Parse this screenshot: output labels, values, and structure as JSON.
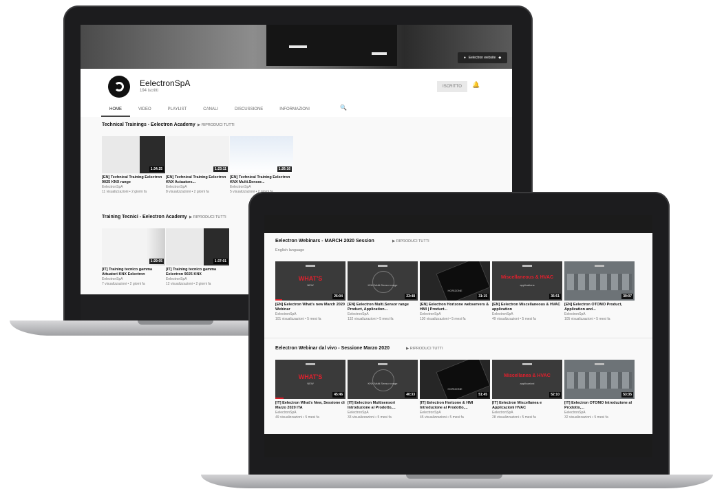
{
  "channel": {
    "banner_link": "Eelectron website",
    "name": "EelectronSpA",
    "subscribers": "194 iscritti",
    "subscribe_label": "ISCRITTO",
    "tabs": [
      "HOME",
      "VIDEO",
      "PLAYLIST",
      "CANALI",
      "DISCUSSIONE",
      "INFORMAZIONI"
    ],
    "sections": [
      {
        "title": "Technical Trainings - Eelectron Academy",
        "play_all": "RIPRODUCI TUTTI",
        "videos": [
          {
            "duration": "1:34:25",
            "title": "[EN] Technical Training Eelectron 9025 KNX range",
            "author": "EelectronSpA",
            "meta": "11 visualizzazioni • 2 giorni fa"
          },
          {
            "duration": "1:23:11",
            "title": "[EN] Technical Training Eelectron KNX Actuators...",
            "author": "EelectronSpA",
            "meta": "8 visualizzazioni • 2 giorni fa"
          },
          {
            "duration": "1:26:16",
            "title": "[EN] Technical Training Eelectron KNX Multi.Sensor...",
            "author": "EelectronSpA",
            "meta": "5 visualizzazioni • 2 giorni fa"
          }
        ]
      },
      {
        "title": "Training Tecnici - Eelectron Academy",
        "play_all": "RIPRODUCI TUTTI",
        "videos": [
          {
            "duration": "1:29:05",
            "title": "[IT] Training tecnico gamma Attuatori KNX Eelectron",
            "author": "EelectronSpA",
            "meta": "7 visualizzazioni • 2 giorni fa"
          },
          {
            "duration": "1:37:01",
            "title": "[IT] Training tecnico gamma Eelectron 9025 KNX",
            "author": "EelectronSpA",
            "meta": "12 visualizzazioni • 2 giorni fa"
          }
        ]
      }
    ]
  },
  "webinars": {
    "sections": [
      {
        "title": "Eelectron Webinars - MARCH 2020 Session",
        "play_all": "RIPRODUCI TUTTI",
        "subtitle": "English language",
        "videos": [
          {
            "duration": "26:04",
            "thumb_big": "WHAT'S",
            "thumb_small": "NEW",
            "title": "[EN] Eelectron What's new March 2020 Webinar",
            "author": "EelectronSpA",
            "meta": "101 visualizzazioni • 5 mesi fa"
          },
          {
            "duration": "23:48",
            "thumb_big": "",
            "thumb_small": "KNX Multi.Sensor range",
            "title": "[EN] Eelectron Multi.Sensor range Product, Application...",
            "author": "EelectronSpA",
            "meta": "132 visualizzazioni • 5 mesi fa"
          },
          {
            "duration": "31:15",
            "thumb_big": "",
            "thumb_small": "HORIZONE",
            "title": "[EN] Eelectron Horizone webservers & HMI | Product...",
            "author": "EelectronSpA",
            "meta": "130 visualizzazioni • 5 mesi fa"
          },
          {
            "duration": "36:51",
            "thumb_big": "Miscellaneous & HVAC",
            "thumb_small": "applications",
            "title": "[EN] Eelectron Miscellaneous & HVAC application",
            "author": "EelectronSpA",
            "meta": "49 visualizzazioni • 5 mesi fa"
          },
          {
            "duration": "39:07",
            "thumb_big": "",
            "thumb_small": "",
            "title": "[EN] Eelectron OTOMO Product, Application and...",
            "author": "EelectronSpA",
            "meta": "105 visualizzazioni • 5 mesi fa"
          }
        ]
      },
      {
        "title": "Eelectron Webinar dal vivo - Sessione Marzo 2020",
        "play_all": "RIPRODUCI TUTTI",
        "videos": [
          {
            "duration": "45:46",
            "thumb_big": "WHAT'S",
            "thumb_small": "NEW",
            "title": "[IT] Eelectron What's New, Sessione di Marzo 2020 ITA",
            "author": "EelectronSpA",
            "meta": "49 visualizzazioni • 5 mesi fa"
          },
          {
            "duration": "40:33",
            "thumb_big": "",
            "thumb_small": "KNX Multi.Sensor range",
            "title": "[IT] Eelectron Multisensori Introduzione al Prodotto,...",
            "author": "EelectronSpA",
            "meta": "33 visualizzazioni • 5 mesi fa"
          },
          {
            "duration": "51:45",
            "thumb_big": "",
            "thumb_small": "HORIZONE",
            "title": "[IT] Eelectron Horizone & HMI Introduzione al Prodotto,...",
            "author": "EelectronSpA",
            "meta": "45 visualizzazioni • 5 mesi fa"
          },
          {
            "duration": "52:10",
            "thumb_big": "Miscellanea & HVAC",
            "thumb_small": "applicazioni",
            "title": "[IT] Eelectron Miscellanea e Applicazioni HVAC",
            "author": "EelectronSpA",
            "meta": "28 visualizzazioni • 5 mesi fa"
          },
          {
            "duration": "53:35",
            "thumb_big": "",
            "thumb_small": "",
            "title": "[IT] Eelectron OTOMO Introduzione al Prodotto,...",
            "author": "EelectronSpA",
            "meta": "32 visualizzazioni • 5 mesi fa"
          }
        ]
      }
    ]
  },
  "colors": {
    "accent_red": "#d8202a",
    "frame": "#1c1c1e",
    "page_bg": "#f9f9f9"
  }
}
